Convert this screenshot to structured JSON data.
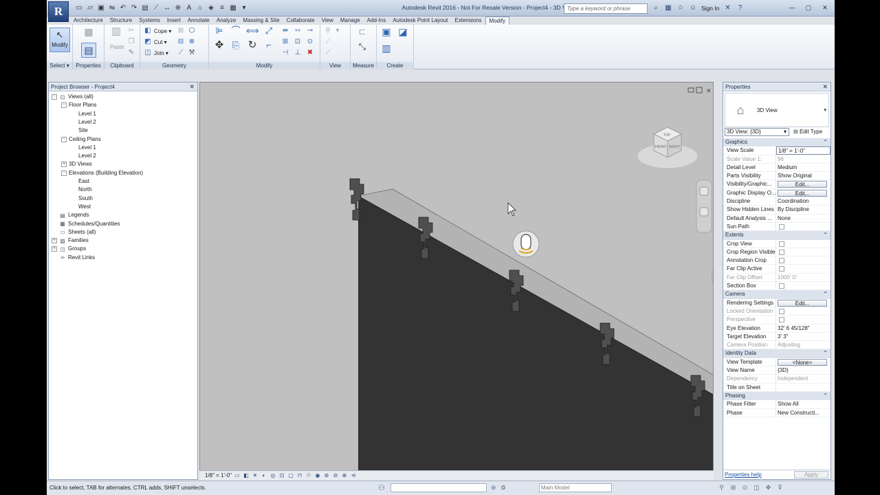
{
  "window": {
    "title": "Autodesk Revit 2016 - Not For Resale Version -     Project4 - 3D View: {3D}"
  },
  "app": {
    "logo": "R"
  },
  "search": {
    "placeholder": "Type a keyword or phrase"
  },
  "account": {
    "sign_in": "Sign In"
  },
  "tabs": [
    "Architecture",
    "Structure",
    "Systems",
    "Insert",
    "Annotate",
    "Analyze",
    "Massing & Site",
    "Collaborate",
    "View",
    "Manage",
    "Add-Ins",
    "Autodesk Point Layout",
    "Extensions",
    "Modify"
  ],
  "active_tab": "Modify",
  "ribbon": {
    "modify_label": "Modify",
    "select_label": "Select",
    "properties_label": "Properties",
    "clipboard_label": "Clipboard",
    "paste_label": "Paste",
    "cope_label": "Cope",
    "cut_label": "Cut",
    "join_label": "Join",
    "geometry_label": "Geometry",
    "modify_panel_label": "Modify",
    "view_label": "View",
    "measure_label": "Measure",
    "create_label": "Create"
  },
  "browser": {
    "title": "Project Browser - Project4",
    "items": [
      {
        "label": "Views (all)",
        "level": 0,
        "toggle": "-",
        "icon": "views-icon"
      },
      {
        "label": "Floor Plans",
        "level": 1,
        "toggle": "-"
      },
      {
        "label": "Level 1",
        "level": 2
      },
      {
        "label": "Level 2",
        "level": 2
      },
      {
        "label": "Site",
        "level": 2
      },
      {
        "label": "Ceiling Plans",
        "level": 1,
        "toggle": "-"
      },
      {
        "label": "Level 1",
        "level": 2
      },
      {
        "label": "Level 2",
        "level": 2
      },
      {
        "label": "3D Views",
        "level": 1,
        "toggle": "+"
      },
      {
        "label": "Elevations (Building Elevation)",
        "level": 1,
        "toggle": "-"
      },
      {
        "label": "East",
        "level": 2
      },
      {
        "label": "North",
        "level": 2
      },
      {
        "label": "South",
        "level": 2
      },
      {
        "label": "West",
        "level": 2
      },
      {
        "label": "Legends",
        "level": 0,
        "icon": "legends-icon"
      },
      {
        "label": "Schedules/Quantities",
        "level": 0,
        "icon": "schedules-icon"
      },
      {
        "label": "Sheets (all)",
        "level": 0,
        "icon": "sheets-icon"
      },
      {
        "label": "Families",
        "level": 0,
        "toggle": "+",
        "icon": "families-icon"
      },
      {
        "label": "Groups",
        "level": 0,
        "toggle": "+",
        "icon": "groups-icon"
      },
      {
        "label": "Revit Links",
        "level": 0,
        "icon": "links-icon"
      }
    ]
  },
  "viewcube": {
    "top": "TOP",
    "front": "FRONT",
    "right": "RIGHT"
  },
  "viewbar": {
    "scale": "1/8\" = 1'-0\""
  },
  "properties": {
    "title": "Properties",
    "type_name": "3D View",
    "view_selector": "3D View: {3D}",
    "edit_type": "Edit Type",
    "rows": [
      {
        "section": "Graphics"
      },
      {
        "key": "View Scale",
        "value": "1/8\" = 1'-0\"",
        "boxed": true
      },
      {
        "key": "Scale Value    1:",
        "value": "96",
        "disabled": true
      },
      {
        "key": "Detail Level",
        "value": "Medium"
      },
      {
        "key": "Parts Visibility",
        "value": "Show Original"
      },
      {
        "key": "Visibility/Graphic...",
        "button": "Edit..."
      },
      {
        "key": "Graphic Display O...",
        "button": "Edit..."
      },
      {
        "key": "Discipline",
        "value": "Coordination"
      },
      {
        "key": "Show Hidden Lines",
        "value": "By Discipline"
      },
      {
        "key": "Default Analysis ...",
        "value": "None"
      },
      {
        "key": "Sun Path",
        "check": true
      },
      {
        "section": "Extents"
      },
      {
        "key": "Crop View",
        "check": true
      },
      {
        "key": "Crop Region Visible",
        "check": true
      },
      {
        "key": "Annotation Crop",
        "check": true
      },
      {
        "key": "Far Clip Active",
        "check": true
      },
      {
        "key": "Far Clip Offset",
        "value": "1000'  0\"",
        "disabled": true
      },
      {
        "key": "Section Box",
        "check": true
      },
      {
        "section": "Camera"
      },
      {
        "key": "Rendering Settings",
        "button": "Edit..."
      },
      {
        "key": "Locked Orientation",
        "check": true,
        "disabled": true
      },
      {
        "key": "Perspective",
        "check": true,
        "disabled": true
      },
      {
        "key": "Eye Elevation",
        "value": "32'  6 45/128\""
      },
      {
        "key": "Target Elevation",
        "value": "3'  3\""
      },
      {
        "key": "Camera Position",
        "value": "Adjusting",
        "disabled": true
      },
      {
        "section": "Identity Data"
      },
      {
        "key": "View Template",
        "button": "<None>"
      },
      {
        "key": "View Name",
        "value": "{3D}"
      },
      {
        "key": "Dependency",
        "value": "Independent",
        "disabled": true
      },
      {
        "key": "Title on Sheet",
        "value": ""
      },
      {
        "section": "Phasing"
      },
      {
        "key": "Phase Filter",
        "value": "Show All"
      },
      {
        "key": "Phase",
        "value": "New Constructi..."
      }
    ],
    "help_link": "Properties help",
    "apply": "Apply"
  },
  "status": {
    "text": "Click to select, TAB for alternates, CTRL adds, SHIFT unselects.",
    "zero": ":0",
    "model": "Main Model"
  },
  "colors": {
    "accent": "#2f66b3",
    "wall_dark": "#333333",
    "wall_top": "#b3b3b3",
    "viewport_bg": "#c0c0c0"
  }
}
